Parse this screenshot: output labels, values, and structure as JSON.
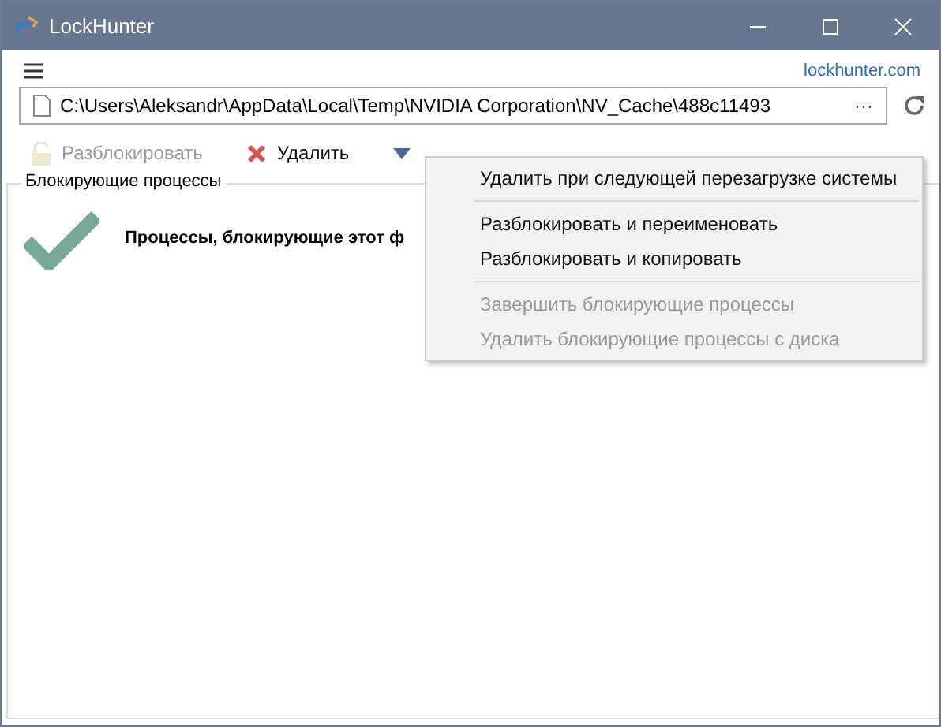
{
  "window": {
    "title": "LockHunter"
  },
  "link": "lockhunter.com",
  "path_field": {
    "value": "C:\\Users\\Aleksandr\\AppData\\Local\\Temp\\NVIDIA Corporation\\NV_Cache\\488c11493",
    "browse": "···"
  },
  "toolbar": [
    {
      "label": "Разблокировать",
      "disabled": true
    },
    {
      "label": "Удалить",
      "disabled": false
    },
    {
      "disabled": false
    }
  ],
  "group": {
    "title": "Блокирующие процессы",
    "message": "Процессы, блокирующие этот ф"
  },
  "menu": [
    {
      "kind": "item",
      "label": "Удалить при следующей перезагрузке системы",
      "disabled": false
    },
    {
      "kind": "separator"
    },
    {
      "kind": "item",
      "label": "Разблокировать и переименовать",
      "disabled": false
    },
    {
      "kind": "item",
      "label": "Разблокировать и копировать",
      "disabled": false
    },
    {
      "kind": "separator"
    },
    {
      "kind": "item",
      "label": "Завершить блокирующие процессы",
      "disabled": true
    },
    {
      "kind": "item",
      "label": "Удалить блокирующие процессы с диска",
      "disabled": true
    }
  ]
}
